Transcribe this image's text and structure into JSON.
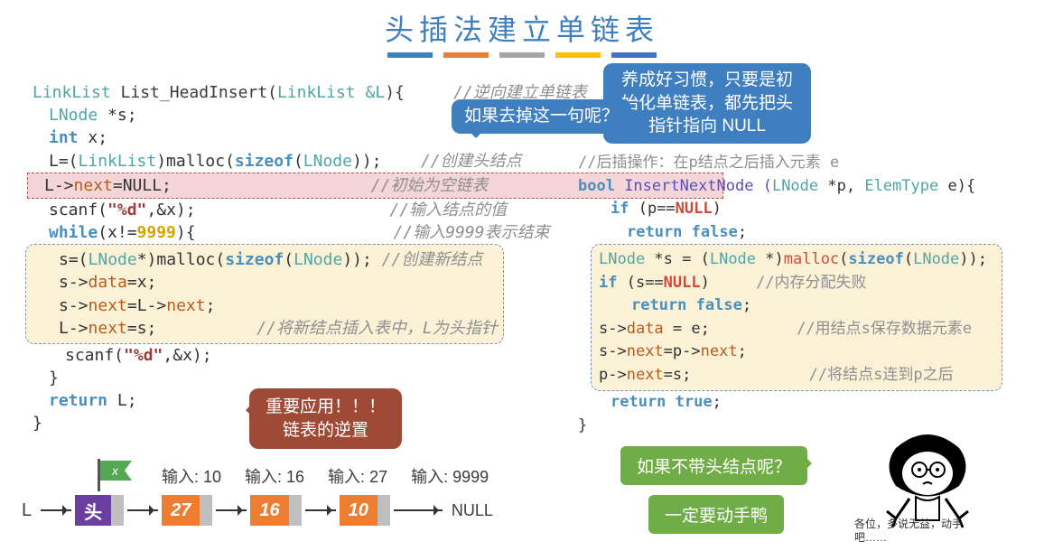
{
  "title": "头插法建立单链表",
  "tip_big": "养成好习惯，只要是初始化单链表，都先把头指针指向 NULL",
  "tip_small": "如果去掉这一句呢？",
  "code_left": {
    "sig_type": "LinkList",
    "sig_name": "List_HeadInsert",
    "sig_param_type": "LinkList",
    "sig_param": "&L",
    "sig_tail": "){",
    "c_sig": "//逆向建立单链表",
    "l2_type": "LNode",
    "l2_rest": " *s;",
    "l3_kw": "int",
    "l3_rest": " x;",
    "l4_a": "L=(",
    "l4_b": "LinkList",
    "l4_c": ")malloc(",
    "l4_d": "sizeof",
    "l4_e": "(",
    "l4_f": "LNode",
    "l4_g": "));",
    "c4": "//创建头结点",
    "l5_a": "L->",
    "l5_b": "next",
    "l5_c": "=NULL;",
    "c5": "//初始为空链表",
    "l6_a": "scanf(",
    "l6_b": "\"%d\"",
    "l6_c": ",&x);",
    "c6": "//输入结点的值",
    "l7_a": "while",
    "l7_b": "(x!=",
    "l7_c": "9999",
    "l7_d": "){",
    "c7": "//输入9999表示结束",
    "l8_a": "s=(",
    "l8_b": "LNode",
    "l8_c": "*)malloc(",
    "l8_d": "sizeof",
    "l8_e": "(",
    "l8_f": "LNode",
    "l8_g": "));",
    "c8": "//创建新结点",
    "l9_a": "s->",
    "l9_b": "data",
    "l9_c": "=x;",
    "l10_a": "s->",
    "l10_b": "next",
    "l10_c": "=L->",
    "l10_d": "next",
    "l10_e": ";",
    "l11_a": "L->",
    "l11_b": "next",
    "l11_c": "=s;",
    "c11": "//将新结点插入表中，L为头指针",
    "l12_a": "scanf(",
    "l12_b": "\"%d\"",
    "l12_c": ",&x);",
    "l13": "}",
    "l14_kw": "return",
    "l14_rest": " L;",
    "l15": "}"
  },
  "brown": "重要应用！！！\n链表的逆置",
  "code_right": {
    "c0": "//后插操作：在p结点之后插入元素 e",
    "r1_a": "bool",
    "r1_b": " InsertNextNode (",
    "r1_c": "LNode",
    "r1_d": " *p, ",
    "r1_e": "ElemType",
    "r1_f": " e){",
    "r2_a": "if",
    "r2_b": " (p==",
    "r2_c": "NULL",
    "r2_d": ")",
    "r3_a": "return",
    "r3_b": " false",
    "r3_c": ";",
    "r4_a": "LNode",
    "r4_b": " *s = (",
    "r4_c": "LNode",
    "r4_d": " *)",
    "r4_e": "malloc",
    "r4_f": "(",
    "r4_g": "sizeof",
    "r4_h": "(",
    "r4_i": "LNode",
    "r4_j": "));",
    "r5_a": "if",
    "r5_b": " (s==",
    "r5_c": "NULL",
    "r5_d": ")",
    "c5": "//内存分配失败",
    "r6_a": "return",
    "r6_b": " false",
    "r6_c": ";",
    "r7_a": "s->",
    "r7_b": "data",
    "r7_c": " = e;",
    "c7": "//用结点s保存数据元素e",
    "r8_a": "s->",
    "r8_b": "next",
    "r8_c": "=p->",
    "r8_d": "next",
    "r8_e": ";",
    "r9_a": "p->",
    "r9_b": "next",
    "r9_c": "=s;",
    "c9": "//将结点s连到p之后",
    "r10_a": "return",
    "r10_b": " true",
    "r10_c": ";",
    "r11": "}"
  },
  "green1": "如果不带头结点呢？",
  "green2": "一定要动手鸭",
  "diagram": {
    "flag": "x",
    "in1": "输入: 10",
    "in2": "输入: 16",
    "in3": "输入: 27",
    "in4": "输入: 9999",
    "L": "L",
    "head": "头",
    "n1": "27",
    "n2": "16",
    "n3": "10",
    "null": "NULL"
  },
  "caption": "各位，多说无益，动手\n吧……"
}
